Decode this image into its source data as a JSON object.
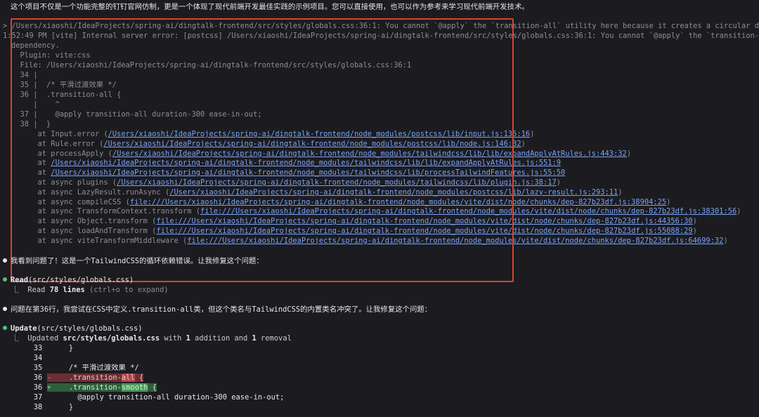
{
  "intro_text": "这个项目不仅是一个功能完整的钉钉官网仿制，更是一个体现了现代前端开发最佳实践的示例项目。您可以直接使用，也可以作为参考来学习现代前端开发技术。",
  "error_block": {
    "line1": "> /Users/xiaoshi/IdeaProjects/spring-ai/dingtalk-frontend/src/styles/globals.css:36:1: You cannot `@apply` the `transition-all` utility here because it creates a circular depe",
    "line2": "1:52:49 PM [vite] Internal server error: [postcss] /Users/xiaoshi/IdeaProjects/spring-ai/dingtalk-frontend/src/styles/globals.css:36:1: You cannot `@apply` the `transition-a",
    "line3": "dependency.",
    "plugin": "  Plugin: vite:css",
    "file": "  File: /Users/xiaoshi/IdeaProjects/spring-ai/dingtalk-frontend/src/styles/globals.css:36:1",
    "code": [
      "  34 |",
      "  35 |  /* 平滑过渡效果 */",
      "  36 |  .transition-all {",
      "     |    ^",
      "  37 |    @apply transition-all duration-300 ease-in-out;",
      "  38 |  }"
    ],
    "stack": [
      {
        "prefix": "      at Input.error (",
        "link": "/Users/xiaoshi/IdeaProjects/spring-ai/dingtalk-frontend/node_modules/postcss/lib/input.js:135:16",
        "suffix": ")"
      },
      {
        "prefix": "      at Rule.error (",
        "link": "/Users/xiaoshi/IdeaProjects/spring-ai/dingtalk-frontend/node_modules/postcss/lib/node.js:146:32",
        "suffix": ")"
      },
      {
        "prefix": "      at processApply (",
        "link": "/Users/xiaoshi/IdeaProjects/spring-ai/dingtalk-frontend/node_modules/tailwindcss/lib/lib/expandApplyAtRules.js:443:32",
        "suffix": ")"
      },
      {
        "prefix": "      at ",
        "link": "/Users/xiaoshi/IdeaProjects/spring-ai/dingtalk-frontend/node_modules/tailwindcss/lib/lib/expandApplyAtRules.js:551:9",
        "suffix": ""
      },
      {
        "prefix": "      at ",
        "link": "/Users/xiaoshi/IdeaProjects/spring-ai/dingtalk-frontend/node_modules/tailwindcss/lib/processTailwindFeatures.js:55:50",
        "suffix": ""
      },
      {
        "prefix": "      at async plugins (",
        "link": "/Users/xiaoshi/IdeaProjects/spring-ai/dingtalk-frontend/node_modules/tailwindcss/lib/plugin.js:38:17",
        "suffix": ")"
      },
      {
        "prefix": "      at async LazyResult.runAsync (",
        "link": "/Users/xiaoshi/IdeaProjects/spring-ai/dingtalk-frontend/node_modules/postcss/lib/lazy-result.js:293:11",
        "suffix": ")"
      },
      {
        "prefix": "      at async compileCSS (",
        "link": "file:///Users/xiaoshi/IdeaProjects/spring-ai/dingtalk-frontend/node_modules/vite/dist/node/chunks/dep-827b23df.js:38904:25",
        "suffix": ")"
      },
      {
        "prefix": "      at async TransformContext.transform (",
        "link": "file:///Users/xiaoshi/IdeaProjects/spring-ai/dingtalk-frontend/node_modules/vite/dist/node/chunks/dep-827b23df.js:38301:56",
        "suffix": ")"
      },
      {
        "prefix": "      at async Object.transform (",
        "link": "file:///Users/xiaoshi/IdeaProjects/spring-ai/dingtalk-frontend/node_modules/vite/dist/node/chunks/dep-827b23df.js:44356:30",
        "suffix": ")"
      },
      {
        "prefix": "      at async loadAndTransform (",
        "link": "file:///Users/xiaoshi/IdeaProjects/spring-ai/dingtalk-frontend/node_modules/vite/dist/node/chunks/dep-827b23df.js:55088:29",
        "suffix": ")"
      },
      {
        "prefix": "      at async viteTransformMiddleware (",
        "link": "file:///Users/xiaoshi/IdeaProjects/spring-ai/dingtalk-frontend/node_modules/vite/dist/node/chunks/dep-827b23df.js:64699:32",
        "suffix": ")"
      }
    ]
  },
  "msg1": "我看到问题了！这是一个TailwindCSS的循环依赖错误。让我修复这个问题：",
  "read_tool": {
    "name": "Read",
    "arg": "(src/styles/globals.css)",
    "result_prefix": "  ⎿  Read ",
    "result_count": "78 lines",
    "result_hint": " (ctrl+o to expand)"
  },
  "msg2": "问题在第36行，我尝试在CSS中定义.transition-all类，但这个类名与TailwindCSS的内置类名冲突了。让我修复这个问题：",
  "update_tool": {
    "name": "Update",
    "arg": "(src/styles/globals.css)",
    "result_prefix": "  ⎿  Updated ",
    "result_file": "src/styles/globals.css",
    "result_mid": " with ",
    "add_count": "1",
    "mid2": " addition and ",
    "rem_count": "1",
    "suffix": " removal"
  },
  "diff": {
    "l33": "       33      }",
    "l34": "       34",
    "l35": "       35      /* 平滑过渡效果 */",
    "del_num": "       36 ",
    "del_mark": "-",
    "del_pre": "    .transition-",
    "del_hl": "all",
    "del_post": " {",
    "add_num": "       36 ",
    "add_mark": "+",
    "add_pre": "    .transition-",
    "add_hl": "smooth",
    "add_post": " {",
    "l37": "       37        @apply transition-all duration-300 ease-in-out;",
    "l38": "       38      }"
  }
}
